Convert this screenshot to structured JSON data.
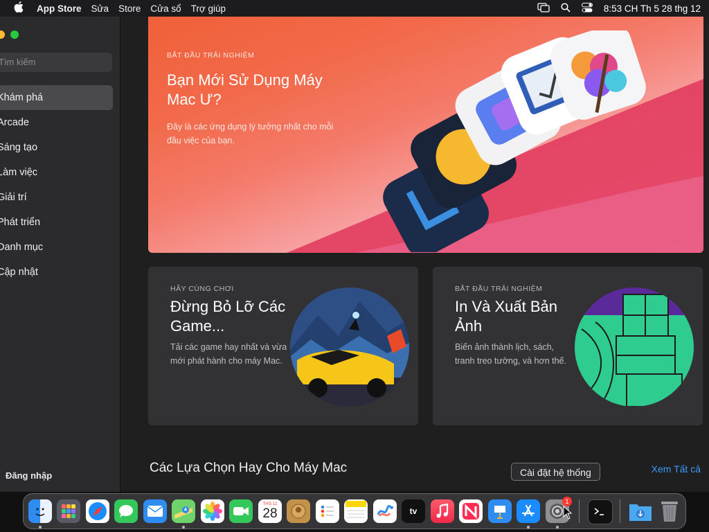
{
  "menubar": {
    "apple": "",
    "app_name": "App Store",
    "items": [
      "Sửa",
      "Store",
      "Cửa sổ",
      "Trợ giúp"
    ],
    "clock": "8:53 CH Th 5 28 thg 12"
  },
  "sidebar": {
    "search_placeholder": "Tìm kiếm",
    "items": [
      {
        "label": "Khám phá",
        "active": true
      },
      {
        "label": "Arcade"
      },
      {
        "label": "Sáng tạo"
      },
      {
        "label": "Làm việc"
      },
      {
        "label": "Giải trí"
      },
      {
        "label": "Phát triển"
      },
      {
        "label": "Danh mục"
      },
      {
        "label": "Cập nhật"
      }
    ],
    "sign_in": "Đăng nhập"
  },
  "hero": {
    "eyebrow": "BẮT ĐẦU TRẢI NGHIỆM",
    "title": "Bạn Mới Sử Dụng Máy Mac Ư?",
    "description": "Đây là các ứng dụng lý tưởng nhất cho mỗi đầu việc của bạn."
  },
  "cards": [
    {
      "eyebrow": "HÃY CÙNG CHƠI",
      "title": "Đừng Bỏ Lỡ Các Game...",
      "description": "Tải các game hay nhất và vừa mới phát hành cho máy Mac."
    },
    {
      "eyebrow": "BẮT ĐẦU TRẢI NGHIỆM",
      "title": "In Và Xuất Bản Ảnh",
      "description": "Biến ảnh thành lịch, sách, tranh treo tường, và hơn thế."
    }
  ],
  "section": {
    "title": "Các Lựa Chọn Hay Cho Máy Mac",
    "see_all": "Xem Tất cả"
  },
  "tooltip": "Cài đặt hệ thống",
  "dock": {
    "calendar_month": "THG 12",
    "calendar_day": "28",
    "tv_label": "tv",
    "settings_badge": "1",
    "icons": [
      "finder-icon",
      "launchpad-icon",
      "safari-icon",
      "messages-icon",
      "mail-icon",
      "maps-icon",
      "photos-icon",
      "facetime-icon",
      "calendar-icon",
      "contacts-icon",
      "reminders-icon",
      "notes-icon",
      "freeform-icon",
      "apple-tv-icon",
      "music-icon",
      "news-icon",
      "keynote-icon",
      "app-store-icon",
      "system-settings-icon",
      "terminal-icon",
      "downloads-folder-icon",
      "trash-icon"
    ]
  }
}
